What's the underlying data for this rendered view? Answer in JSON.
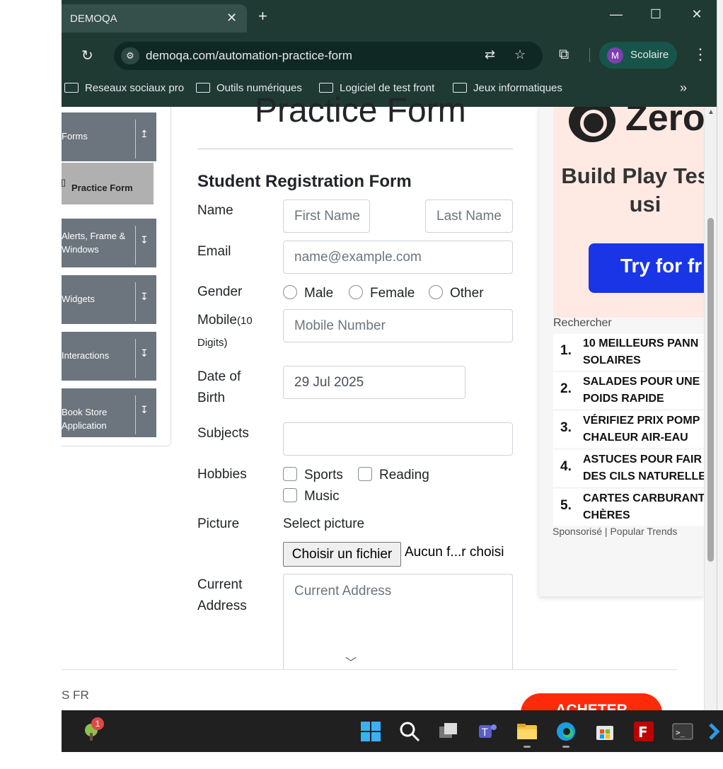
{
  "browser": {
    "tab_title": "DEMOQA",
    "tab_close": "✕",
    "new_tab": "+",
    "url": "demoqa.com/automation-practice-form",
    "profile_initial": "M",
    "profile_name": "Scolaire",
    "window_minimize": "—",
    "window_maximize": "☐",
    "window_close": "✕",
    "bookmarks": [
      "Reseaux sociaux pro",
      "Outils numériques",
      "Logiciel de test front",
      "Jeux informatiques"
    ],
    "bookmarks_more": "»"
  },
  "sidebar": {
    "groups": [
      {
        "label": "Forms",
        "arrow": "↥"
      },
      {
        "label": "Alerts, Frame & Windows",
        "arrow": "↧"
      },
      {
        "label": "Widgets",
        "arrow": "↧"
      },
      {
        "label": "Interactions",
        "arrow": "↧"
      },
      {
        "label": "Book Store Application",
        "arrow": "↧"
      }
    ],
    "active_item": "Practice Form"
  },
  "form": {
    "page_title": "Practice Form",
    "title": "Student Registration Form",
    "name_label": "Name",
    "first_name_placeholder": "First Name",
    "last_name_placeholder": "Last Name",
    "email_label": "Email",
    "email_placeholder": "name@example.com",
    "gender_label": "Gender",
    "gender_options": [
      "Male",
      "Female",
      "Other"
    ],
    "mobile_label": "Mobile",
    "mobile_hint": "(10 Digits)",
    "mobile_placeholder": "Mobile Number",
    "dob_label": "Date of Birth",
    "dob_value": "29 Jul 2025",
    "subjects_label": "Subjects",
    "hobbies_label": "Hobbies",
    "hobbies": [
      "Sports",
      "Reading",
      "Music"
    ],
    "picture_label": "Picture",
    "select_picture": "Select picture",
    "file_button": "Choisir un fichier",
    "file_status": "Aucun f...r choisi",
    "address_label": "Current Address",
    "address_placeholder": "Current Address"
  },
  "ad": {
    "brand": "Zero",
    "headline": "Build Play Tests usi",
    "cta": "Try for fr",
    "search_label": "Rechercher",
    "trends": [
      {
        "num": "1.",
        "text": "10 MEILLEURS PANN\nSOLAIRES"
      },
      {
        "num": "2.",
        "text": "SALADES POUR UNE\nPOIDS RAPIDE"
      },
      {
        "num": "3.",
        "text": "VÉRIFIEZ PRIX POMP\nCHALEUR AIR-EAU"
      },
      {
        "num": "4.",
        "text": "ASTUCES POUR FAIR\nDES CILS NATURELLE"
      },
      {
        "num": "5.",
        "text": "CARTES CARBURANT\nCHÈRES"
      }
    ],
    "sponsor_label": "Sponsorisé",
    "sponsor_source": "Popular Trends"
  },
  "bottom_ad": {
    "brand": "S FR",
    "cta": "ACHETER"
  },
  "taskbar": {
    "badge_count": "1"
  }
}
